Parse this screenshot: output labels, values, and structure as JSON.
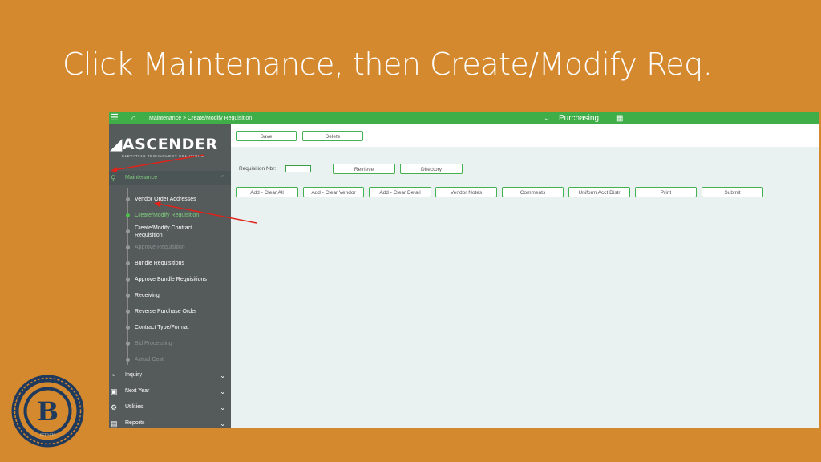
{
  "slide": {
    "title": "Click Maintenance, then Create/Modify Req."
  },
  "topbar": {
    "menu_icon": "hamburger-icon",
    "home_icon": "home-icon",
    "breadcrumb": "Maintenance > Create/Modify Requisition",
    "module": "Purchasing",
    "module_chevron_icon": "chevron-down-icon",
    "grid_icon": "grid-icon"
  },
  "sidebar": {
    "logo": "ASCENDER",
    "logo_tagline": "ELEVATING TECHNOLOGY SOLUTIONS",
    "maintenance": {
      "label": "Maintenance",
      "icon": "wrench-icon"
    },
    "items": [
      {
        "label": "Vendor Order Addresses"
      },
      {
        "label": "Create/Modify Requisition"
      },
      {
        "label": "Create/Modify Contract"
      },
      {
        "label": "Requisition"
      },
      {
        "label": "Approve Requisition"
      },
      {
        "label": "Bundle Requisitions"
      },
      {
        "label": "Approve Bundle Requisitions"
      },
      {
        "label": "Receiving"
      },
      {
        "label": "Reverse Purchase Order"
      },
      {
        "label": "Contract Type/Format"
      },
      {
        "label": "Bid Processing"
      },
      {
        "label": "Actual Cost"
      }
    ],
    "sections": [
      {
        "label": "Inquiry",
        "icon": "eye-icon"
      },
      {
        "label": "Next Year",
        "icon": "calendar-icon"
      },
      {
        "label": "Utilities",
        "icon": "gear-icon"
      },
      {
        "label": "Reports",
        "icon": "document-icon"
      }
    ]
  },
  "toolbar": {
    "save": "Save",
    "delete": "Delete"
  },
  "form": {
    "req_label": "Requisition Nbr:",
    "req_value": "",
    "retrieve": "Retrieve",
    "directory": "Directory",
    "actions": {
      "add_clear_all": "Add - Clear All",
      "add_clear_vendor": "Add - Clear Vendor",
      "add_clear_detail": "Add - Clear Detail",
      "vendor_notes": "Vendor Notes",
      "comments": "Comments",
      "uniform_acct_distr": "Uniform Acct Distr",
      "print": "Print",
      "submit": "Submit"
    }
  },
  "annotations": {
    "arrow_color": "#e0241b"
  },
  "badge": {
    "letter": "B",
    "text": "EST 1876"
  },
  "colors": {
    "slide_bg": "#D4892E",
    "accent_green": "#3fae49",
    "sidebar_bg": "#555a5b",
    "badge_navy": "#1f3a5c"
  }
}
